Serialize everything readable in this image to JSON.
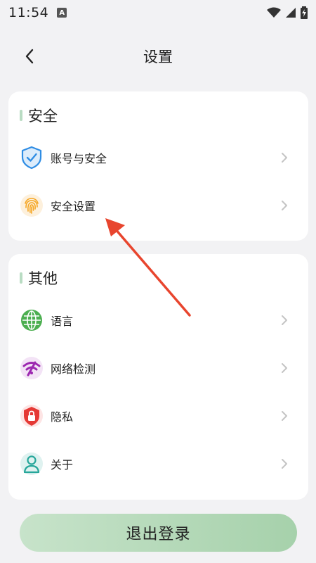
{
  "status_bar": {
    "time": "11:54",
    "notification_letter": "A",
    "icons": [
      "wifi-icon",
      "signal-icon",
      "battery-charging-icon"
    ]
  },
  "header": {
    "title": "设置",
    "back_icon": "chevron-left-icon"
  },
  "sections": [
    {
      "title": "安全",
      "items": [
        {
          "label": "账号与安全",
          "icon": "shield-check-icon",
          "color": "#2f8de4"
        },
        {
          "label": "安全设置",
          "icon": "fingerprint-icon",
          "color": "#f5a623"
        }
      ]
    },
    {
      "title": "其他",
      "items": [
        {
          "label": "语言",
          "icon": "globe-icon",
          "color": "#4caf50"
        },
        {
          "label": "网络检测",
          "icon": "wifi-signal-icon",
          "color": "#9c27b0"
        },
        {
          "label": "隐私",
          "icon": "lock-shield-icon",
          "color": "#e53935"
        },
        {
          "label": "关于",
          "icon": "person-icon",
          "color": "#26a69a"
        }
      ]
    }
  ],
  "logout": {
    "label": "退出登录"
  },
  "colors": {
    "section_marker": "#b9dcc3",
    "annotation_arrow": "#e8452e",
    "logout_gradient_start": "#c7e3ca",
    "logout_gradient_end": "#a6d1ab"
  }
}
